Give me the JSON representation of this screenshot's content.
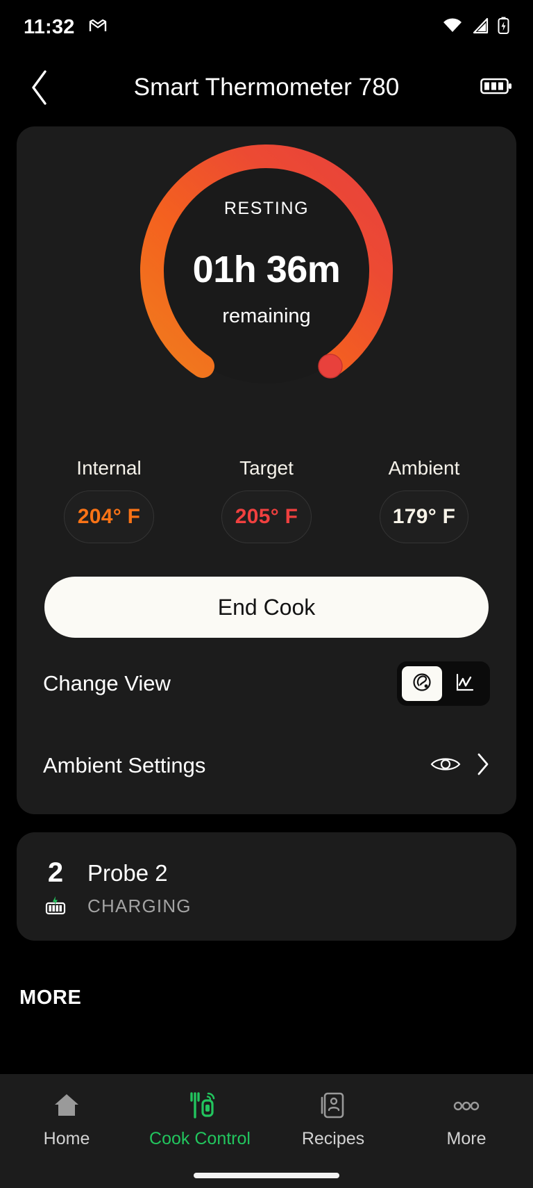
{
  "status_bar": {
    "time": "11:32",
    "icons": [
      "gmail-icon",
      "wifi-icon",
      "cellular-signal-icon",
      "battery-charging-icon"
    ]
  },
  "app_bar": {
    "back_label": "‹",
    "title": "Smart Thermometer 780",
    "battery_icon": "battery-full-icon"
  },
  "gauge": {
    "status": "RESTING",
    "time_remaining": "01h 36m",
    "sub_label": "remaining",
    "arc_start_color": "#f07b1d",
    "arc_end_color": "#e8413c",
    "track_color": "#242424"
  },
  "temperatures": [
    {
      "label": "Internal",
      "value": "204° F",
      "color": "#f97316"
    },
    {
      "label": "Target",
      "value": "205° F",
      "color": "#f0403f"
    },
    {
      "label": "Ambient",
      "value": "179° F",
      "color": "#f7f3e8"
    }
  ],
  "primary_action": {
    "label": "End Cook"
  },
  "rows": [
    {
      "label": "Change View",
      "control": "segmented",
      "options": [
        {
          "icon": "dial-gauge-icon",
          "selected": true
        },
        {
          "icon": "line-chart-icon",
          "selected": false
        }
      ]
    },
    {
      "label": "Ambient Settings",
      "control": "navigation",
      "icons": [
        "eye-icon",
        "chevron-right-icon"
      ]
    }
  ],
  "probe": {
    "number": "2",
    "name": "Probe 2",
    "status": "CHARGING",
    "battery_icon": "battery-charging-icon",
    "accent": "#22c55e"
  },
  "more_section": {
    "heading": "MORE"
  },
  "bottom_nav": {
    "active_color": "#22c55e",
    "items": [
      {
        "label": "Home",
        "icon": "home-icon",
        "active": false
      },
      {
        "label": "Cook Control",
        "icon": "cook-control-icon",
        "active": true
      },
      {
        "label": "Recipes",
        "icon": "recipes-icon",
        "active": false
      },
      {
        "label": "More",
        "icon": "more-dots-icon",
        "active": false
      }
    ]
  }
}
